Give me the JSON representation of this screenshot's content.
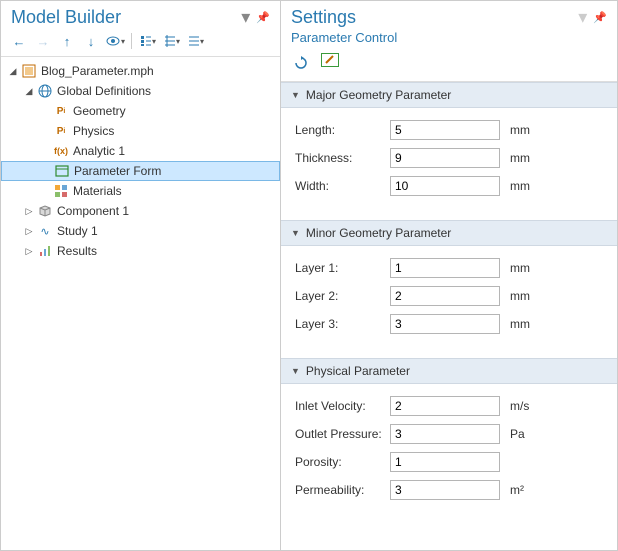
{
  "model_builder": {
    "title": "Model Builder",
    "tree": {
      "root": {
        "label": "Blog_Parameter.mph",
        "children": {
          "global_defs": {
            "label": "Global Definitions",
            "children": {
              "geometry": {
                "label": "Geometry"
              },
              "physics": {
                "label": "Physics"
              },
              "analytic1": {
                "label": "Analytic 1"
              },
              "param_form": {
                "label": "Parameter Form"
              },
              "materials": {
                "label": "Materials"
              }
            }
          },
          "component1": {
            "label": "Component 1"
          },
          "study1": {
            "label": "Study 1"
          },
          "results": {
            "label": "Results"
          }
        }
      }
    }
  },
  "settings": {
    "title": "Settings",
    "subtitle": "Parameter Control",
    "sections": {
      "major": {
        "title": "Major Geometry Parameter",
        "fields": {
          "length": {
            "label": "Length:",
            "value": "5",
            "unit": "mm"
          },
          "thickness": {
            "label": "Thickness:",
            "value": "9",
            "unit": "mm"
          },
          "width": {
            "label": "Width:",
            "value": "10",
            "unit": "mm"
          }
        }
      },
      "minor": {
        "title": "Minor Geometry Parameter",
        "fields": {
          "layer1": {
            "label": "Layer 1:",
            "value": "1",
            "unit": "mm"
          },
          "layer2": {
            "label": "Layer 2:",
            "value": "2",
            "unit": "mm"
          },
          "layer3": {
            "label": "Layer 3:",
            "value": "3",
            "unit": "mm"
          }
        }
      },
      "physical": {
        "title": "Physical Parameter",
        "fields": {
          "inlet_velocity": {
            "label": "Inlet Velocity:",
            "value": "2",
            "unit": "m/s"
          },
          "outlet_pressure": {
            "label": "Outlet Pressure:",
            "value": "3",
            "unit": "Pa"
          },
          "porosity": {
            "label": "Porosity:",
            "value": "1",
            "unit": ""
          },
          "permeability": {
            "label": "Permeability:",
            "value": "3",
            "unit": "m²"
          }
        }
      }
    }
  }
}
